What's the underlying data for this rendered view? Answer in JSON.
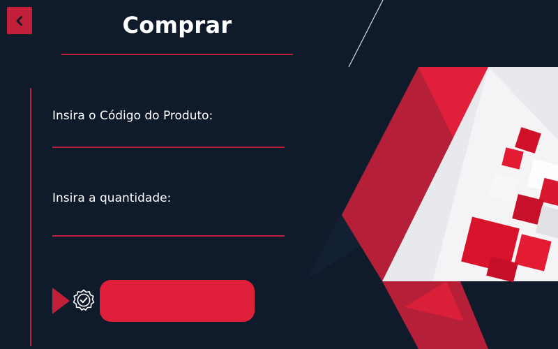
{
  "header": {
    "title": "Comprar",
    "back_icon": "chevron-left-icon"
  },
  "form": {
    "product_code": {
      "label": "Insira o Código do Produto:",
      "value": "",
      "placeholder": ""
    },
    "quantity": {
      "label": "Insira a quantidade:",
      "value": "",
      "placeholder": ""
    },
    "submit": {
      "label": "",
      "icon": "verified-check-badge-icon",
      "pointer_icon": "play-triangle-icon"
    }
  },
  "colors": {
    "background": "#0f1a2a",
    "accent": "#c21f3a",
    "button": "#e0203a",
    "text": "#ffffff"
  }
}
